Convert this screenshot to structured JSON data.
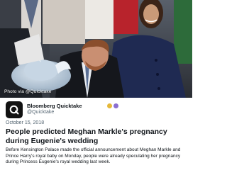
{
  "photo": {
    "credit": "Photo via @Quicktake"
  },
  "account": {
    "name": "Bloomberg Quicktake",
    "handle": "@Quicktake",
    "brand_color": "#111111",
    "verified_badge_color": "#e5b83a",
    "affiliate_badge_color": "#8b6fd1"
  },
  "post": {
    "date": "October 15, 2018",
    "headline": "People predicted Meghan Markle's pregnancy during Eugenie's wedding",
    "description": "Before Kensington Palace made the official announcement about Meghan Markle and Prince Harry's royal baby on Monday, people were already speculating her pregnancy during Princess Eugenie's royal wedding last week."
  }
}
